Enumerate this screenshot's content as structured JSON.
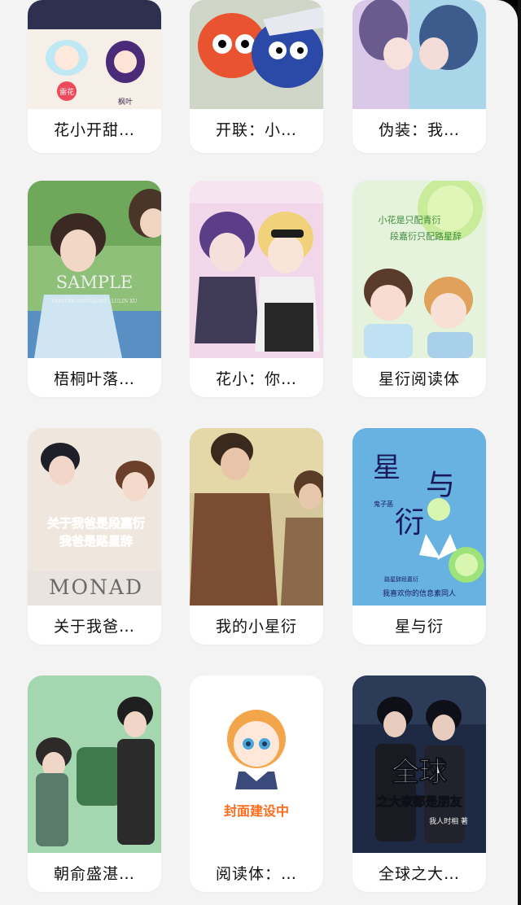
{
  "books": [
    {
      "title": "花小开甜…",
      "cover_text": [
        "雷花",
        "枫叶"
      ]
    },
    {
      "title": "开联：小…",
      "cover_text": []
    },
    {
      "title": "伪装：我…",
      "cover_text": []
    },
    {
      "title": "梧桐叶落…",
      "cover_text": [
        "SAMPLE",
        "PAINTER SPOTLIGHT / LULIN XU"
      ]
    },
    {
      "title": "花小：你…",
      "cover_text": []
    },
    {
      "title": "星衍阅读体",
      "cover_text": [
        "小花是只配青衍",
        "段嘉衍只配路星辞"
      ]
    },
    {
      "title": "关于我爸…",
      "cover_text": [
        "关于我爸是段嘉衍",
        "我爸是路星辞",
        "MONAD"
      ]
    },
    {
      "title": "我的小星衍",
      "cover_text": []
    },
    {
      "title": "星与衍",
      "cover_text": [
        "星",
        "与",
        "衍",
        "鬼子菡",
        "路星辞段嘉衍",
        "我喜欢你的信息素同人"
      ]
    },
    {
      "title": "朝俞盛湛…",
      "cover_text": []
    },
    {
      "title": "阅读体：…",
      "cover_text": [
        "封面建设中"
      ]
    },
    {
      "title": "全球之大…",
      "cover_text": [
        "全球",
        "之大家都是朋友",
        "我人时相 著"
      ]
    }
  ],
  "colors": {
    "panel_bg": "#f3f3f3",
    "card_bg": "#ffffff",
    "title_color": "#111111",
    "placeholder_text": "#ff6b1a"
  }
}
